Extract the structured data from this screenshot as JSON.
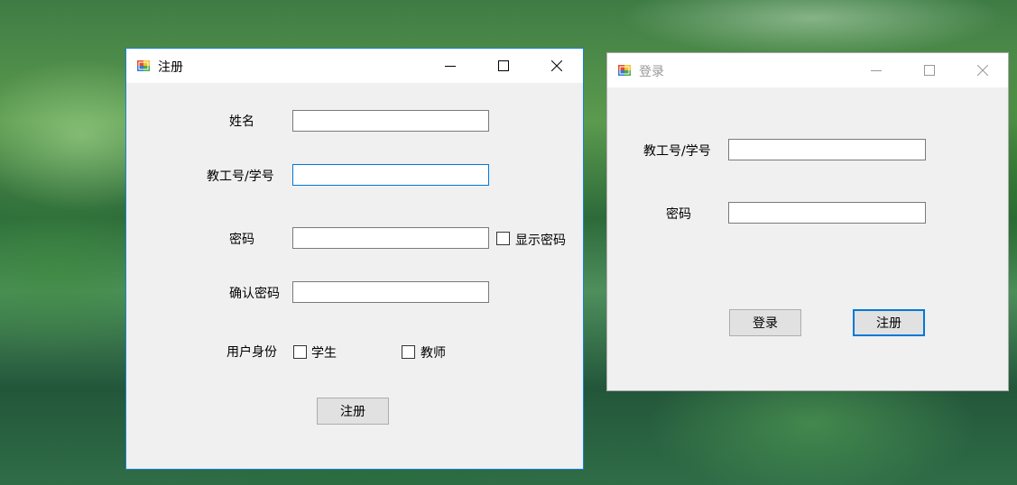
{
  "register": {
    "title": "注册",
    "labels": {
      "name": "姓名",
      "id": "教工号/学号",
      "password": "密码",
      "confirm": "确认密码",
      "role": "用户身份"
    },
    "fields": {
      "name": "",
      "id": "",
      "password": "",
      "confirm": ""
    },
    "show_password": "显示密码",
    "role_student": "学生",
    "role_teacher": "教师",
    "submit": "注册"
  },
  "login": {
    "title": "登录",
    "labels": {
      "id": "教工号/学号",
      "password": "密码"
    },
    "fields": {
      "id": "",
      "password": ""
    },
    "login_button": "登录",
    "register_button": "注册"
  },
  "colors": {
    "focus_border": "#0078d7",
    "window_bg": "#f0f0f0"
  }
}
